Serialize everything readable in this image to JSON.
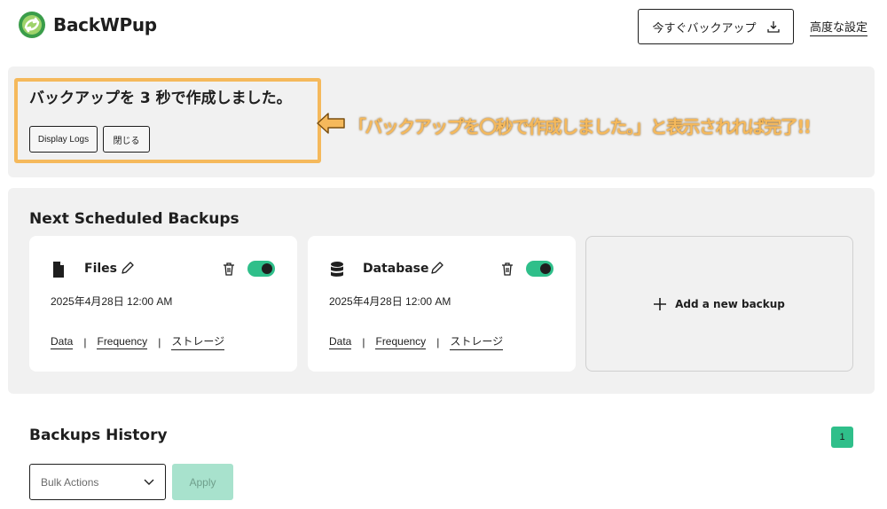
{
  "header": {
    "app_name": "BackWPup",
    "backup_now_label": "今すぐバックアップ",
    "advanced_settings_label": "高度な設定"
  },
  "notice": {
    "message": "バックアップを 3 秒で作成しました。",
    "display_logs_label": "Display Logs",
    "close_label": "閉じる",
    "annotation": "「バックアップを〇秒で作成しました。」と表示されれば完了!!"
  },
  "scheduled": {
    "title": "Next Scheduled Backups",
    "cards": [
      {
        "title": "Files",
        "icon": "file-icon",
        "date": "2025年4月28日 12:00 AM",
        "enabled": true,
        "links": [
          "Data",
          "Frequency",
          "ストレージ"
        ]
      },
      {
        "title": "Database",
        "icon": "database-icon",
        "date": "2025年4月28日 12:00 AM",
        "enabled": true,
        "links": [
          "Data",
          "Frequency",
          "ストレージ"
        ]
      }
    ],
    "add_label": "Add a new backup"
  },
  "history": {
    "title": "Backups History",
    "current_page": "1",
    "bulk_actions_placeholder": "Bulk Actions",
    "apply_label": "Apply"
  },
  "colors": {
    "accent_green": "#2fbf8a",
    "highlight_orange": "#f5b95c",
    "panel_gray": "#f1f1f1"
  }
}
